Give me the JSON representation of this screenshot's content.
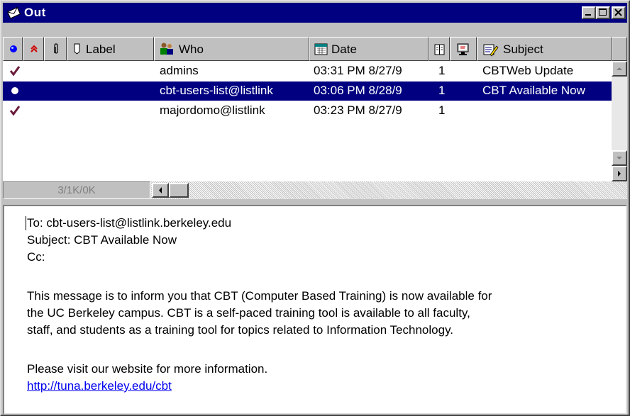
{
  "window": {
    "title": "Out"
  },
  "columns": {
    "label": "Label",
    "who": "Who",
    "date": "Date",
    "subject": "Subject"
  },
  "messages": [
    {
      "status": "sent",
      "who": "admins",
      "date": "03:31 PM 8/27/9",
      "priority": "1",
      "subject": "CBTWeb Update",
      "selected": false
    },
    {
      "status": "queued",
      "who": "cbt-users-list@listlink",
      "date": "03:06 PM 8/28/9",
      "priority": "1",
      "subject": "CBT Available Now",
      "selected": true
    },
    {
      "status": "sent",
      "who": "majordomo@listlink",
      "date": "03:23 PM 8/27/9",
      "priority": "1",
      "subject": "",
      "selected": false
    }
  ],
  "status_text": "3/1K/0K",
  "preview": {
    "to": "To: cbt-users-list@listlink.berkeley.edu",
    "subject": "Subject: CBT Available Now",
    "cc": "Cc:",
    "body_line1": "This message is to inform you that CBT (Computer Based Training) is now available for",
    "body_line2": "the UC Berkeley campus.  CBT is a self-paced training tool is available to all faculty,",
    "body_line3": "staff, and students as a training tool for topics related to Information Technology.",
    "body_line4": "Please visit our website for more information.",
    "link": "http://tuna.berkeley.edu/cbt"
  },
  "icons": {
    "title": "envelope-icon",
    "status_sent": "checkmark-icon",
    "status_queued": "bullet-icon"
  },
  "colors": {
    "title_bar": "#000080",
    "selection": "#000080",
    "check": "#6b1c3c",
    "link": "#0000ee"
  }
}
